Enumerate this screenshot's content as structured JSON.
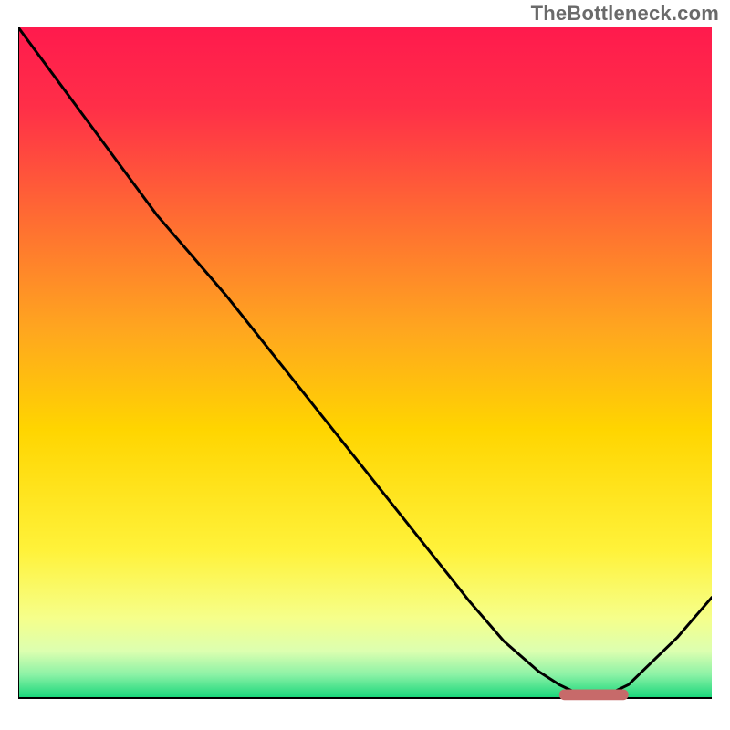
{
  "watermark": "TheBottleneck.com",
  "chart_data": {
    "type": "line",
    "title": "",
    "xlabel": "",
    "ylabel": "",
    "xlim": [
      0,
      100
    ],
    "ylim": [
      0,
      100
    ],
    "series": [
      {
        "name": "curve",
        "color": "#000000",
        "x": [
          0,
          5,
          10,
          15,
          20,
          25,
          30,
          35,
          40,
          45,
          50,
          55,
          60,
          65,
          70,
          75,
          78,
          80,
          83,
          85,
          88,
          90,
          95,
          100
        ],
        "y": [
          100,
          93,
          86,
          79,
          72,
          66,
          60,
          53.5,
          47,
          40.5,
          34,
          27.5,
          21,
          14.5,
          8.5,
          4,
          2,
          1,
          0.5,
          0.5,
          2,
          4,
          9,
          15
        ]
      }
    ],
    "optimal_band": {
      "name": "optimal-range-marker",
      "color": "#c76a6a",
      "x_start": 78,
      "x_end": 88,
      "y": 0.5,
      "thickness": 1.6
    },
    "background_gradient": {
      "stops": [
        {
          "offset": 0.0,
          "color": "#ff1a4d"
        },
        {
          "offset": 0.12,
          "color": "#ff2f48"
        },
        {
          "offset": 0.28,
          "color": "#ff6a33"
        },
        {
          "offset": 0.45,
          "color": "#ffa61f"
        },
        {
          "offset": 0.6,
          "color": "#ffd500"
        },
        {
          "offset": 0.78,
          "color": "#fff23a"
        },
        {
          "offset": 0.88,
          "color": "#f6ff8a"
        },
        {
          "offset": 0.93,
          "color": "#dcffb0"
        },
        {
          "offset": 0.965,
          "color": "#8cf2a6"
        },
        {
          "offset": 1.0,
          "color": "#17d67a"
        }
      ]
    },
    "axis_color": "#000000",
    "axis_width": 2
  }
}
